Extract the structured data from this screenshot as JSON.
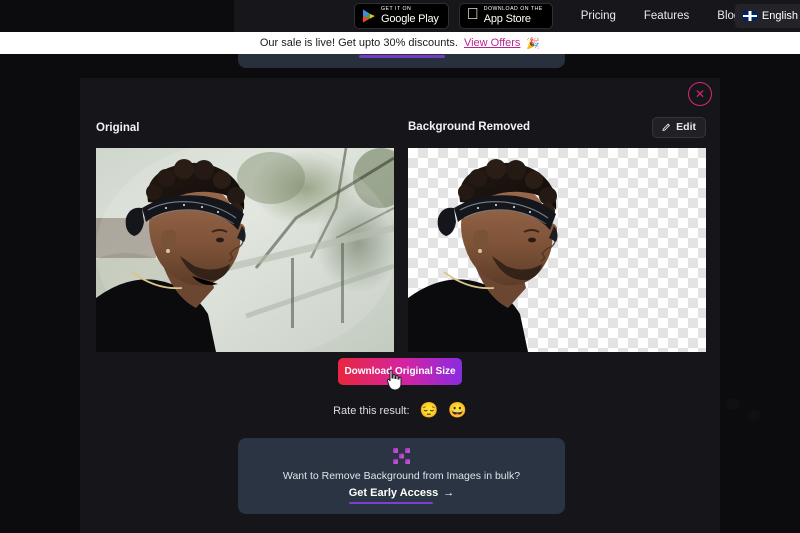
{
  "nav": {
    "google_play": {
      "small": "GET IT ON",
      "big": "Google Play",
      "icon": "google-play-icon"
    },
    "app_store": {
      "small": "Download on the",
      "big": "App Store",
      "icon": "apple-icon"
    },
    "links": [
      {
        "label": "Pricing"
      },
      {
        "label": "Features"
      },
      {
        "label": "Blog"
      }
    ],
    "language": {
      "label": "English",
      "flag": "uk-flag-icon"
    }
  },
  "banner": {
    "text": "Our sale is live! Get upto 30% discounts.",
    "link": "View Offers",
    "emoji": "🎉"
  },
  "ghost": {
    "text": "Want to Remove Background from Images in bulk?"
  },
  "modal": {
    "close_label": "✕",
    "original": {
      "label": "Original",
      "alt": "Man in profile wearing a bandana headband and black shirt, blurred outdoor background"
    },
    "removed": {
      "label": "Background Removed",
      "alt": "Same man cut out on a transparent checkerboard background"
    },
    "edit_button": {
      "label": "Edit",
      "icon": "pencil-icon"
    },
    "download_button": {
      "label": "Download Original Size"
    },
    "rate": {
      "label": "Rate this result:",
      "options": [
        {
          "name": "unsatisfied-emoji",
          "glyph": "😔"
        },
        {
          "name": "satisfied-emoji",
          "glyph": "😀"
        }
      ]
    },
    "promo": {
      "logo": "bulk-logo-icon",
      "text": "Want to Remove Background from Images in bulk?",
      "cta": "Get Early Access",
      "cta_arrow": "→"
    }
  },
  "colors": {
    "page_bg": "#0c0c0f",
    "modal_bg": "#16161a",
    "accent_pink": "#d6277e",
    "promo_bg": "#2b3442",
    "promo_underline": "#7b3fd4",
    "banner_link": "#b7248f"
  }
}
